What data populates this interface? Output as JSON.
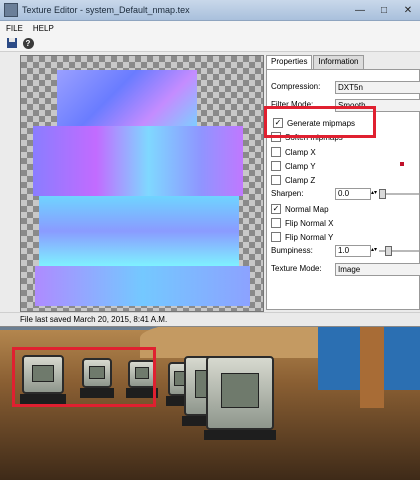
{
  "window": {
    "title": "Texture Editor - system_Default_nmap.tex",
    "controls": [
      "—",
      "□",
      "✕"
    ]
  },
  "menu": {
    "file": "FILE",
    "help": "HELP"
  },
  "toolbar": {
    "save_icon": "save-icon",
    "help_icon": "help-icon"
  },
  "tabs": [
    {
      "label": "Properties",
      "active": true
    },
    {
      "label": "Information",
      "active": false
    }
  ],
  "properties": {
    "compression_label": "Compression:",
    "compression_value": "DXT5n",
    "filter_mode_label": "Filter Mode:",
    "filter_mode_value": "Smooth",
    "generate_mipmaps_label": "Generate mipmaps",
    "generate_mipmaps_checked": true,
    "soften_mipmaps_label": "Soften mipmaps",
    "clamp_x_label": "Clamp X",
    "clamp_y_label": "Clamp Y",
    "clamp_z_label": "Clamp Z",
    "sharpen_label": "Sharpen:",
    "sharpen_value": "0.0",
    "normal_map_label": "Normal Map",
    "normal_map_checked": true,
    "flip_normal_x_label": "Flip Normal X",
    "flip_normal_y_label": "Flip Normal Y",
    "bumpiness_label": "Bumpiness:",
    "bumpiness_value": "1.0",
    "texture_mode_label": "Texture Mode:",
    "texture_mode_value": "Image"
  },
  "status": {
    "text": "File last saved March 20, 2015, 8:41 A.M."
  },
  "colors": {
    "highlight": "#e02030",
    "titlebar": "#b8cce4"
  }
}
